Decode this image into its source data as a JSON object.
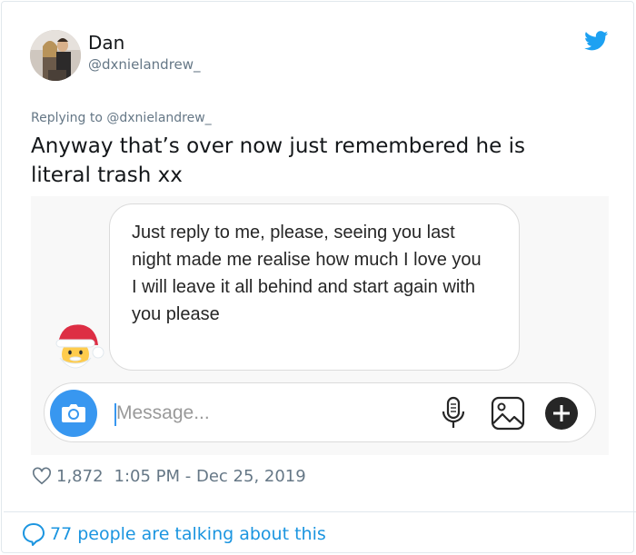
{
  "tweet": {
    "display_name": "Dan",
    "handle": "@dxnielandrew_",
    "replying_to": "Replying to @dxnielandrew_",
    "text": "Anyway that’s over now just remembered he is literal trash xx",
    "likes": "1,872",
    "timestamp": "1:05 PM - Dec 25, 2019",
    "talking": "77 people are talking about this"
  },
  "embedded_chat": {
    "message_lines": [
      "Just reply to me, please, seeing you last night made me realise how much I love you",
      "I will leave it all behind and start again with you please"
    ],
    "input_placeholder": "Message..."
  },
  "icons": {
    "brand": "twitter-bird-icon",
    "sender_avatar": "santa-emoji",
    "composer": [
      "camera-icon",
      "microphone-icon",
      "gallery-icon",
      "plus-icon"
    ],
    "footer": [
      "heart-icon",
      "speech-bubble-icon"
    ]
  },
  "colors": {
    "twitter_blue": "#1da1f2",
    "link_blue": "#1b95e0",
    "camera_blue": "#3897f0",
    "secondary_text": "#657786"
  }
}
